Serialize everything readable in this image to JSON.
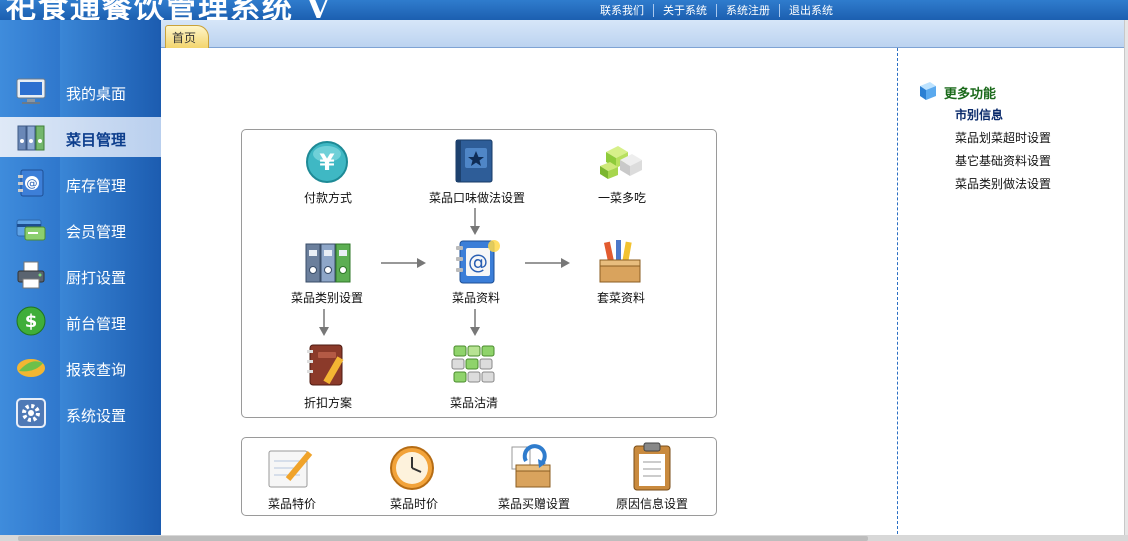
{
  "app": {
    "title": "祀食通餐饮管理系统 V"
  },
  "top_links": [
    "联系我们",
    "关于系统",
    "系统注册",
    "退出系统"
  ],
  "sidebar": {
    "items": [
      {
        "label": "我的桌面",
        "icon": "monitor-icon",
        "active": false
      },
      {
        "label": "菜目管理",
        "icon": "binders-icon",
        "active": true
      },
      {
        "label": "库存管理",
        "icon": "address-book-icon",
        "active": false
      },
      {
        "label": "会员管理",
        "icon": "member-card-icon",
        "active": false
      },
      {
        "label": "厨打设置",
        "icon": "printer-icon",
        "active": false
      },
      {
        "label": "前台管理",
        "icon": "dollar-icon",
        "active": false
      },
      {
        "label": "报表查询",
        "icon": "leaf-icon",
        "active": false
      },
      {
        "label": "系统设置",
        "icon": "gear-icon",
        "active": false
      }
    ]
  },
  "tabs": [
    {
      "label": "首页"
    }
  ],
  "flow": {
    "payment": {
      "label": "付款方式",
      "icon": "yen-icon"
    },
    "taste": {
      "label": "菜品口味做法设置",
      "icon": "book-star-icon"
    },
    "one_dish": {
      "label": "一菜多吃",
      "icon": "cubes-icon"
    },
    "category": {
      "label": "菜品类别设置",
      "icon": "binders-icon"
    },
    "dish_info": {
      "label": "菜品资料",
      "icon": "address-book-icon"
    },
    "set_meal": {
      "label": "套菜资料",
      "icon": "toolbox-icon"
    },
    "discount": {
      "label": "折扣方案",
      "icon": "notebook-pencil-icon"
    },
    "sold_out": {
      "label": "菜品沽清",
      "icon": "blocks-icon"
    }
  },
  "quick": [
    {
      "label": "菜品特价",
      "icon": "notepad-pencil-icon"
    },
    {
      "label": "菜品时价",
      "icon": "clock-icon"
    },
    {
      "label": "菜品买赠设置",
      "icon": "gift-box-icon"
    },
    {
      "label": "原因信息设置",
      "icon": "clipboard-icon"
    }
  ],
  "more": {
    "title": "更多功能",
    "icon": "cube-icon",
    "links": [
      "市别信息",
      "菜品划菜超时设置",
      "基它基础资料设置",
      "菜品类别做法设置"
    ]
  },
  "colors": {
    "sidebar_blue": "#2f77cc",
    "active_text": "#0c3d8c",
    "more_title": "#1b6a1b",
    "tab_yellow": "#f3d56e"
  }
}
